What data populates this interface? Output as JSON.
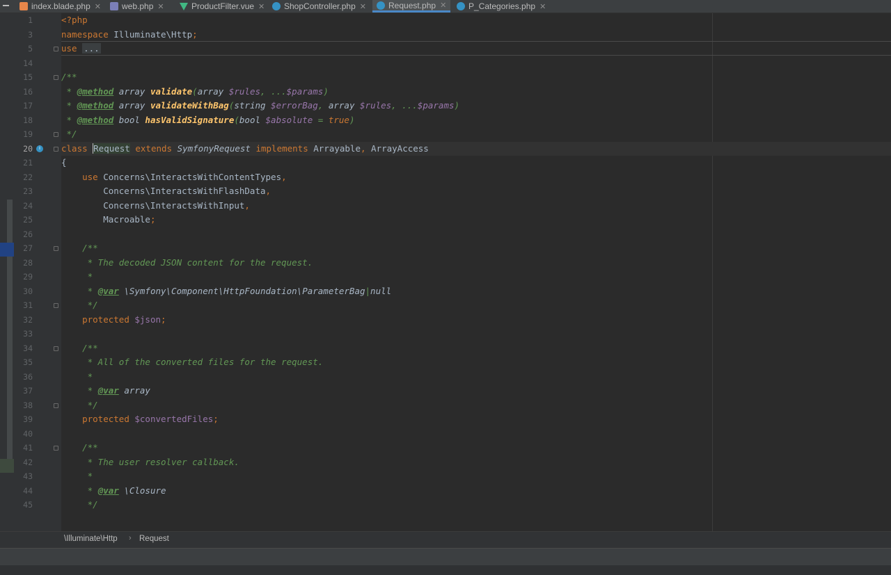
{
  "tabs": [
    {
      "label": "index.blade.php",
      "icon": "html-file-icon",
      "active": false
    },
    {
      "label": "web.php",
      "icon": "php-file-icon",
      "active": false
    },
    {
      "label": "ProductFilter.vue",
      "icon": "vue-file-icon",
      "active": false
    },
    {
      "label": "ShopController.php",
      "icon": "php-class-icon",
      "active": false
    },
    {
      "label": "Request.php",
      "icon": "php-class-icon",
      "active": true
    },
    {
      "label": "P_Categories.php",
      "icon": "php-class-icon",
      "active": false
    }
  ],
  "code": {
    "current_line": "20",
    "lines": [
      {
        "n": "1",
        "parts": [
          [
            "t",
            "<?php"
          ]
        ]
      },
      {
        "n": "3",
        "parts": [
          [
            "kw",
            "namespace "
          ],
          [
            "p",
            "Illuminate\\Http"
          ],
          [
            "kw",
            ";"
          ]
        ]
      },
      {
        "n": "5",
        "parts": [
          [
            "kw",
            "use "
          ],
          [
            "fold",
            "..."
          ]
        ]
      },
      {
        "n": "14",
        "parts": []
      },
      {
        "n": "15",
        "parts": [
          [
            "cm",
            "/**"
          ]
        ]
      },
      {
        "n": "16",
        "parts": [
          [
            "cm",
            " * "
          ],
          [
            "tag",
            "@method"
          ],
          [
            "ctyp",
            " array "
          ],
          [
            "cfn",
            "validate"
          ],
          [
            "cm",
            "("
          ],
          [
            "ctyp",
            "array "
          ],
          [
            "cvar",
            "$rules"
          ],
          [
            "cm",
            ", ..."
          ],
          [
            "cvar",
            "$params"
          ],
          [
            "cm",
            ")"
          ]
        ]
      },
      {
        "n": "17",
        "parts": [
          [
            "cm",
            " * "
          ],
          [
            "tag",
            "@method"
          ],
          [
            "ctyp",
            " array "
          ],
          [
            "cfn",
            "validateWithBag"
          ],
          [
            "cm",
            "("
          ],
          [
            "ctyp",
            "string "
          ],
          [
            "cvar",
            "$errorBag"
          ],
          [
            "cm",
            ", "
          ],
          [
            "ctyp",
            "array "
          ],
          [
            "cvar",
            "$rules"
          ],
          [
            "cm",
            ", ..."
          ],
          [
            "cvar",
            "$params"
          ],
          [
            "cm",
            ")"
          ]
        ]
      },
      {
        "n": "18",
        "parts": [
          [
            "cm",
            " * "
          ],
          [
            "tag",
            "@method"
          ],
          [
            "ctyp",
            " bool "
          ],
          [
            "cfn",
            "hasValidSignature"
          ],
          [
            "cm",
            "("
          ],
          [
            "ctyp",
            "bool "
          ],
          [
            "cvar",
            "$absolute"
          ],
          [
            "cm",
            " = "
          ],
          [
            "kwi",
            "true"
          ],
          [
            "cm",
            ")"
          ]
        ]
      },
      {
        "n": "19",
        "parts": [
          [
            "cm",
            " */"
          ]
        ]
      },
      {
        "n": "20",
        "parts": [
          [
            "kw",
            "class "
          ],
          [
            "caret",
            ""
          ],
          [
            "hl",
            "Request"
          ],
          [
            "kw",
            " extends "
          ],
          [
            "cls",
            "SymfonyRequest"
          ],
          [
            "kw",
            " implements "
          ],
          [
            "p",
            "Arrayable"
          ],
          [
            "kw",
            ", "
          ],
          [
            "p",
            "ArrayAccess"
          ]
        ]
      },
      {
        "n": "21",
        "parts": [
          [
            "p",
            "{"
          ]
        ]
      },
      {
        "n": "22",
        "parts": [
          [
            "p",
            "    "
          ],
          [
            "kw",
            "use "
          ],
          [
            "p",
            "Concerns\\InteractsWithContentTypes"
          ],
          [
            "kw",
            ","
          ]
        ]
      },
      {
        "n": "23",
        "parts": [
          [
            "p",
            "        Concerns\\InteractsWithFlashData"
          ],
          [
            "kw",
            ","
          ]
        ]
      },
      {
        "n": "24",
        "parts": [
          [
            "p",
            "        Concerns\\InteractsWithInput"
          ],
          [
            "kw",
            ","
          ]
        ]
      },
      {
        "n": "25",
        "parts": [
          [
            "p",
            "        Macroable"
          ],
          [
            "kw",
            ";"
          ]
        ]
      },
      {
        "n": "26",
        "parts": []
      },
      {
        "n": "27",
        "parts": [
          [
            "cm",
            "    /**"
          ]
        ]
      },
      {
        "n": "28",
        "parts": [
          [
            "cm",
            "     * The decoded JSON content for the request."
          ]
        ]
      },
      {
        "n": "29",
        "parts": [
          [
            "cm",
            "     *"
          ]
        ]
      },
      {
        "n": "30",
        "parts": [
          [
            "cm",
            "     * "
          ],
          [
            "tag",
            "@var"
          ],
          [
            "ctyp",
            " \\Symfony\\Component\\HttpFoundation\\ParameterBag"
          ],
          [
            "cm",
            "|"
          ],
          [
            "ctyp",
            "null"
          ]
        ]
      },
      {
        "n": "31",
        "parts": [
          [
            "cm",
            "     */"
          ]
        ]
      },
      {
        "n": "32",
        "parts": [
          [
            "p",
            "    "
          ],
          [
            "kw",
            "protected "
          ],
          [
            "var",
            "$json"
          ],
          [
            "kw",
            ";"
          ]
        ]
      },
      {
        "n": "33",
        "parts": []
      },
      {
        "n": "34",
        "parts": [
          [
            "cm",
            "    /**"
          ]
        ]
      },
      {
        "n": "35",
        "parts": [
          [
            "cm",
            "     * All of the converted files for the request."
          ]
        ]
      },
      {
        "n": "36",
        "parts": [
          [
            "cm",
            "     *"
          ]
        ]
      },
      {
        "n": "37",
        "parts": [
          [
            "cm",
            "     * "
          ],
          [
            "tag",
            "@var"
          ],
          [
            "ctyp",
            " array"
          ]
        ]
      },
      {
        "n": "38",
        "parts": [
          [
            "cm",
            "     */"
          ]
        ]
      },
      {
        "n": "39",
        "parts": [
          [
            "p",
            "    "
          ],
          [
            "kw",
            "protected "
          ],
          [
            "var",
            "$convertedFiles"
          ],
          [
            "kw",
            ";"
          ]
        ]
      },
      {
        "n": "40",
        "parts": []
      },
      {
        "n": "41",
        "parts": [
          [
            "cm",
            "    /**"
          ]
        ]
      },
      {
        "n": "42",
        "parts": [
          [
            "cm",
            "     * The user resolver callback."
          ]
        ]
      },
      {
        "n": "43",
        "parts": [
          [
            "cm",
            "     *"
          ]
        ]
      },
      {
        "n": "44",
        "parts": [
          [
            "cm",
            "     * "
          ],
          [
            "tag",
            "@var"
          ],
          [
            "ctyp",
            " \\Closure"
          ]
        ]
      },
      {
        "n": "45",
        "parts": [
          [
            "cm",
            "     */"
          ]
        ]
      }
    ]
  },
  "breadcrumb": {
    "namespace": "\\Illuminate\\Http",
    "class": "Request"
  },
  "colors": {
    "editor_bg": "#2b2b2b",
    "keyword": "#cc7832",
    "doc_comment": "#629755",
    "variable": "#9876aa",
    "function": "#ffc66d",
    "text": "#a9b7c6"
  }
}
